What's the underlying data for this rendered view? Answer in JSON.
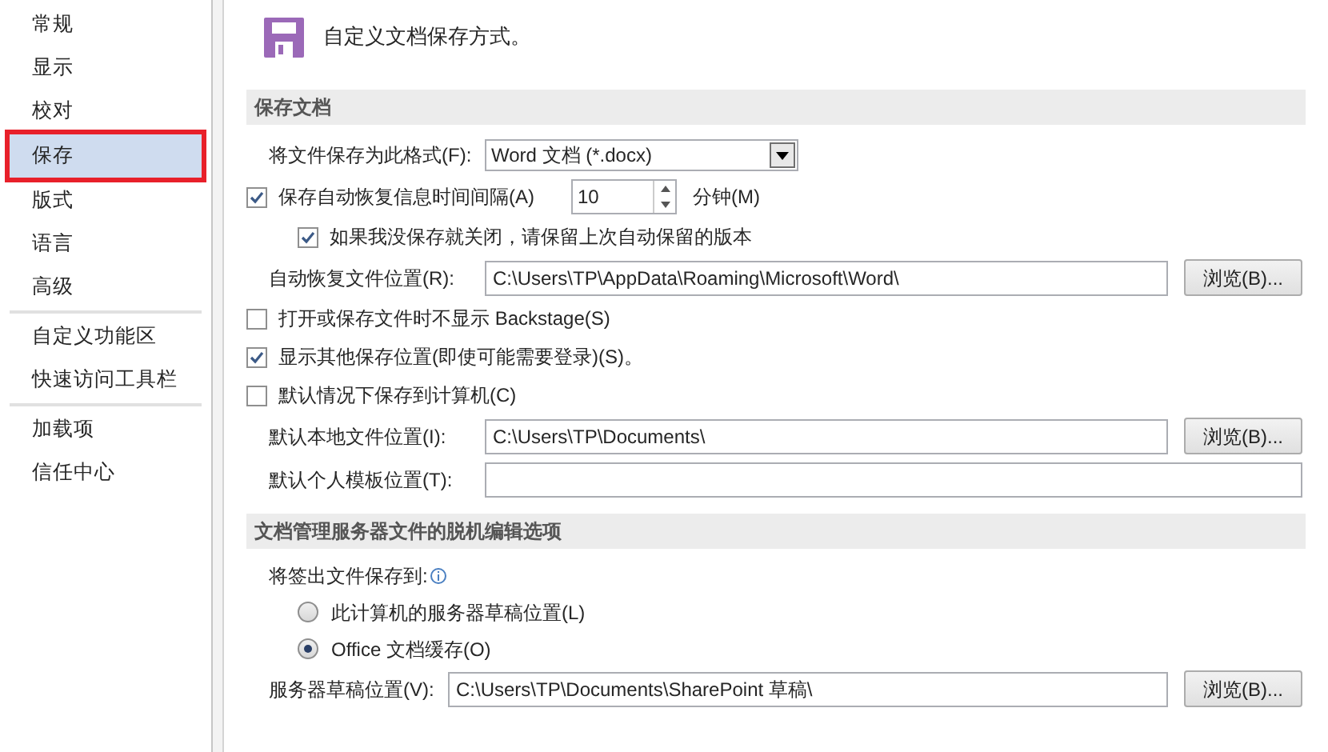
{
  "sidebar": {
    "groups": [
      {
        "items": [
          {
            "label": "常规",
            "selected": false,
            "highlighted": false
          },
          {
            "label": "显示",
            "selected": false,
            "highlighted": false
          },
          {
            "label": "校对",
            "selected": false,
            "highlighted": false
          },
          {
            "label": "保存",
            "selected": true,
            "highlighted": true
          },
          {
            "label": "版式",
            "selected": false,
            "highlighted": false
          },
          {
            "label": "语言",
            "selected": false,
            "highlighted": false
          },
          {
            "label": "高级",
            "selected": false,
            "highlighted": false
          }
        ]
      },
      {
        "items": [
          {
            "label": "自定义功能区",
            "selected": false,
            "highlighted": false
          },
          {
            "label": "快速访问工具栏",
            "selected": false,
            "highlighted": false
          }
        ]
      },
      {
        "items": [
          {
            "label": "加载项",
            "selected": false,
            "highlighted": false
          },
          {
            "label": "信任中心",
            "selected": false,
            "highlighted": false
          }
        ]
      }
    ]
  },
  "header": {
    "title": "自定义文档保存方式。"
  },
  "sections": [
    {
      "title": "保存文档",
      "rows": [
        {
          "kind": "select",
          "label": "将文件保存为此格式(F):",
          "value": "Word 文档 (*.docx)"
        },
        {
          "kind": "spin",
          "label": "保存自动恢复信息时间间隔(A)",
          "checked": true,
          "value": "10",
          "unit": "分钟(M)"
        },
        {
          "kind": "subcheckbox",
          "label": "如果我没保存就关闭，请保留上次自动保留的版本",
          "checked": true
        },
        {
          "kind": "path",
          "label": "自动恢复文件位置(R):",
          "value": "C:\\Users\\TP\\AppData\\Roaming\\Microsoft\\Word\\",
          "button": "浏览(B)..."
        },
        {
          "kind": "checkbox",
          "label": "打开或保存文件时不显示 Backstage(S)",
          "checked": false
        },
        {
          "kind": "checkbox",
          "label": "显示其他保存位置(即使可能需要登录)(S)。",
          "checked": true
        },
        {
          "kind": "checkbox",
          "label": "默认情况下保存到计算机(C)",
          "checked": false
        },
        {
          "kind": "path",
          "label": "默认本地文件位置(I):",
          "value": "C:\\Users\\TP\\Documents\\",
          "button": "浏览(B)..."
        },
        {
          "kind": "path",
          "label": "默认个人模板位置(T):"
        }
      ]
    },
    {
      "title": "文档管理服务器文件的脱机编辑选项",
      "rows": [
        {
          "kind": "heading",
          "label": "将签出文件保存到:"
        },
        {
          "kind": "radio",
          "label": "此计算机的服务器草稿位置(L)",
          "selected": false
        },
        {
          "kind": "radio",
          "label": "Office 文档缓存(O)",
          "selected": true
        },
        {
          "kind": "path_compact",
          "label": "服务器草稿位置(V):",
          "value": "C:\\Users\\TP\\Documents\\SharePoint 草稿\\",
          "button": "浏览(B)..."
        }
      ]
    }
  ]
}
